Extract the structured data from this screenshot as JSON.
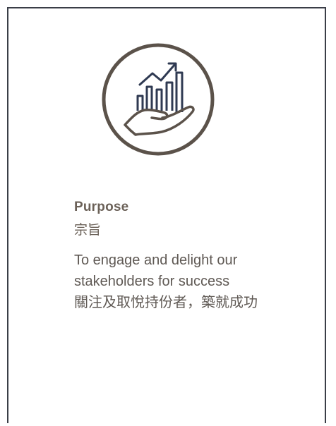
{
  "card": {
    "title_en": "Purpose",
    "title_zh": "宗旨",
    "description_lines": [
      "To engage and delight our",
      "stakeholders for success",
      "關注及取悅持份者，築就成功"
    ],
    "icon": "hand-holding-growth-chart-icon"
  },
  "colors": {
    "border": "#3a3e47",
    "circle": "#5b524a",
    "chart": "#2f3a52",
    "title": "#6b6158",
    "body_text": "#5f5954"
  }
}
